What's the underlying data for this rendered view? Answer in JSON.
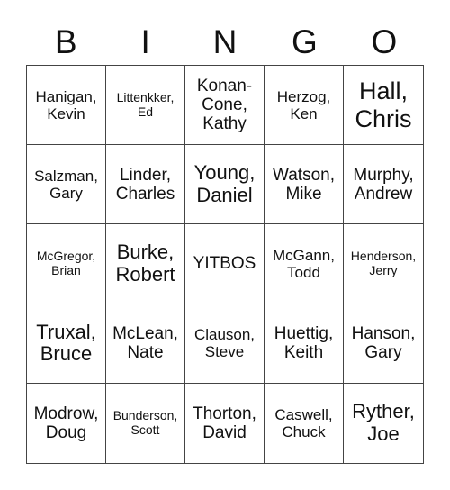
{
  "header": [
    "B",
    "I",
    "N",
    "G",
    "O"
  ],
  "cells": [
    [
      "Hanigan,\nKevin",
      "Littenkker,\nEd",
      "Konan-\nCone,\nKathy",
      "Herzog,\nKen",
      "Hall,\nChris"
    ],
    [
      "Salzman,\nGary",
      "Linder,\nCharles",
      "Young,\nDaniel",
      "Watson,\nMike",
      "Murphy,\nAndrew"
    ],
    [
      "McGregor,\nBrian",
      "Burke,\nRobert",
      "YITBOS",
      "McGann,\nTodd",
      "Henderson,\nJerry"
    ],
    [
      "Truxal,\nBruce",
      "McLean,\nNate",
      "Clauson,\nSteve",
      "Huettig,\nKeith",
      "Hanson,\nGary"
    ],
    [
      "Modrow,\nDoug",
      "Bunderson,\nScott",
      "Thorton,\nDavid",
      "Caswell,\nChuck",
      "Ryther,\nJoe"
    ]
  ]
}
